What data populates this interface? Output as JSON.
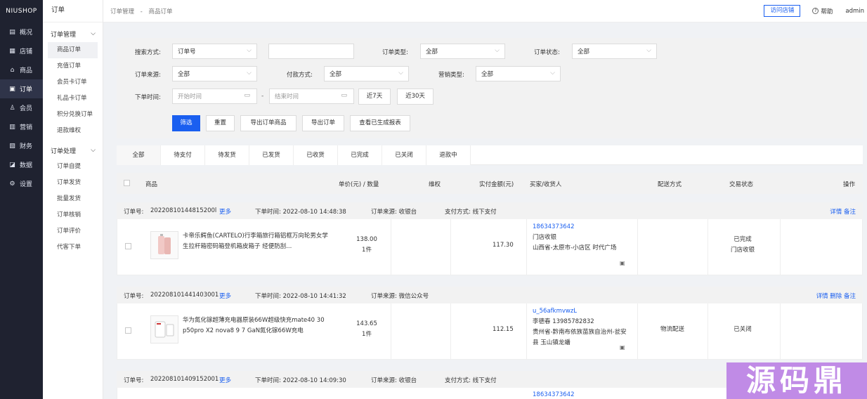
{
  "brand": "NIUSHOP",
  "main_nav": [
    {
      "label": "概况",
      "icon": "overview-icon",
      "glyph": "▤"
    },
    {
      "label": "店铺",
      "icon": "store-icon",
      "glyph": "▦"
    },
    {
      "label": "商品",
      "icon": "goods-icon",
      "glyph": "⌂"
    },
    {
      "label": "订单",
      "icon": "order-icon",
      "glyph": "▣"
    },
    {
      "label": "会员",
      "icon": "member-icon",
      "glyph": "♙"
    },
    {
      "label": "营销",
      "icon": "marketing-icon",
      "glyph": "▥"
    },
    {
      "label": "财务",
      "icon": "finance-icon",
      "glyph": "▧"
    },
    {
      "label": "数据",
      "icon": "data-icon",
      "glyph": "◪"
    },
    {
      "label": "设置",
      "icon": "settings-icon",
      "glyph": "⚙"
    }
  ],
  "sub_nav": {
    "title": "订单",
    "group1": "订单管理",
    "group1_items": [
      "商品订单",
      "充值订单",
      "会员卡订单",
      "礼品卡订单",
      "积分兑换订单",
      "退款维权"
    ],
    "group2": "订单处理",
    "group2_items": [
      "订单自提",
      "订单发货",
      "批量发货",
      "订单核销",
      "订单评价",
      "代客下单"
    ]
  },
  "header": {
    "crumb1": "订单管理",
    "sep": "-",
    "crumb2": "商品订单",
    "visit_store": "访问店铺",
    "help": "帮助",
    "user": "admin"
  },
  "filter": {
    "search_label": "搜索方式:",
    "search_value": "订单号",
    "search_input": "",
    "order_type_label": "订单类型:",
    "order_type_value": "全部",
    "order_status_label": "订单状态:",
    "order_status_value": "全部",
    "source_label": "订单来源:",
    "source_value": "全部",
    "pay_label": "付款方式:",
    "pay_value": "全部",
    "promo_label": "营销类型:",
    "promo_value": "全部",
    "time_label": "下单时间:",
    "start_placeholder": "开始时间",
    "dash": "-",
    "end_placeholder": "结束时间",
    "last7": "近7天",
    "last30": "近30天",
    "btn_filter": "筛选",
    "btn_reset": "重置",
    "btn_export_goods": "导出订单商品",
    "btn_export_orders": "导出订单",
    "btn_reports": "查看已生成报表"
  },
  "tabs": [
    "全部",
    "待支付",
    "待发货",
    "已发货",
    "已收货",
    "已完成",
    "已关闭",
    "退款中"
  ],
  "columns": {
    "goods": "商品",
    "price_qty": "单价(元) / 数量",
    "rights": "维权",
    "paid": "实付金额(元)",
    "buyer": "买家/收货人",
    "delivery": "配送方式",
    "status": "交易状态",
    "ops": "操作"
  },
  "orders": [
    {
      "no_label": "订单号:",
      "no": "20220810144815200l",
      "more": "更多",
      "time": "下单时间: 2022-08-10 14:48:38",
      "source": "订单来源: 收银台",
      "pay": "支付方式: 线下支付",
      "ops": "详情 备注",
      "name": "卡帝乐鳄鱼(CARTELO)行李箱旅行箱铝框万向轮男女学生拉杆箱密码箱登机箱皮箱子 经便防刮...",
      "price": "138.00",
      "qty": "1件",
      "paid": "117.30",
      "buyer_phone": "18634373642",
      "buyer_line2": "门店收银",
      "buyer_line3": "山西省-太原市-小店区 时代广场",
      "delivery": "",
      "status1": "已完成",
      "status2": "门店收银"
    },
    {
      "no_label": "订单号:",
      "no": "202208101441403001",
      "more": "更多",
      "time": "下单时间: 2022-08-10 14:41:32",
      "source": "订单来源: 微信公众号",
      "pay": "",
      "ops": "详情 删除 备注",
      "name": "华为氮化镓超薄充电器原装66W超级快充mate40 30 p50pro X2 nova8 9 7 GaN氮化镓66W充电",
      "price": "143.65",
      "qty": "1件",
      "paid": "112.15",
      "buyer_phone": "u_56afkmvwzL",
      "buyer_line2": "李德春     13985782832",
      "buyer_line3": "贵州省-黔南布依族苗族自治州-瓮安县 玉山镇龙蟠",
      "delivery": "物流配送",
      "status1": "已关闭",
      "status2": ""
    },
    {
      "no_label": "订单号:",
      "no": "202208101409152001",
      "more": "更多",
      "time": "下单时间: 2022-08-10 14:09:30",
      "source": "订单来源: 收银台",
      "pay": "支付方式: 线下支付",
      "ops": "",
      "buyer_phone": "18634373642"
    }
  ],
  "watermark": "源码鼎"
}
